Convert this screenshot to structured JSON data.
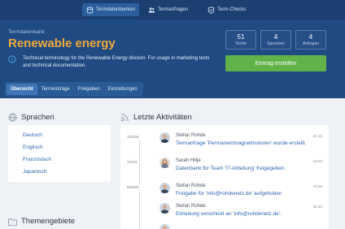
{
  "topnav": {
    "items": [
      {
        "label": "Termdatenbanken",
        "icon": "database-icon",
        "active": true
      },
      {
        "label": "Termanfragen",
        "icon": "users-icon",
        "active": false
      },
      {
        "label": "Term-Checks",
        "icon": "shield-check-icon",
        "active": false
      }
    ]
  },
  "header": {
    "kicker": "Termdatenbank",
    "title": "Renewable energy",
    "description": "Technical terminology for the Renewable Energy division. For usage in marketing texts and technical documentation."
  },
  "stats": [
    {
      "value": "51",
      "label": "Terme"
    },
    {
      "value": "4",
      "label": "Sprachen"
    },
    {
      "value": "4",
      "label": "Anfragen"
    }
  ],
  "create_button": "Eintrag erstellen",
  "tabs": [
    {
      "label": "Übersicht",
      "active": true
    },
    {
      "label": "Termeinträge",
      "active": false
    },
    {
      "label": "Freigaben",
      "active": false
    },
    {
      "label": "Einstellungen",
      "active": false
    }
  ],
  "languages": {
    "heading": "Sprachen",
    "items": [
      "Deutsch",
      "Englisch",
      "Französisch",
      "Japanisch"
    ]
  },
  "activities": {
    "heading": "Letzte Aktivitäten",
    "items": [
      {
        "date": "7/12/21",
        "name": "Stefan Rohde",
        "time": "22:16",
        "text": "Termanfrage 'Permanentmagnetmotoren' wurde erstellt."
      },
      {
        "date": "7/1/21",
        "name": "Sarah Hillje",
        "time": "16:03",
        "text": "Datenbank für Team 'IT-Abteilung' freigegeben."
      },
      {
        "date": "6/29/21",
        "name": "Stefan Rohde",
        "time": "16:50",
        "text": "Freigabe für 'info@rohdenetz.de' aufgehoben"
      },
      {
        "date": "",
        "name": "Stefan Rohde",
        "time": "16:49",
        "text": "Einladung verschickt an 'info@rohdenetz.de'."
      }
    ]
  },
  "themes": {
    "heading": "Themengebiete"
  },
  "colors": {
    "navy": "#1f4a82",
    "accent_orange": "#f0a93a",
    "green": "#62b24a",
    "link_blue": "#2b67b0"
  }
}
